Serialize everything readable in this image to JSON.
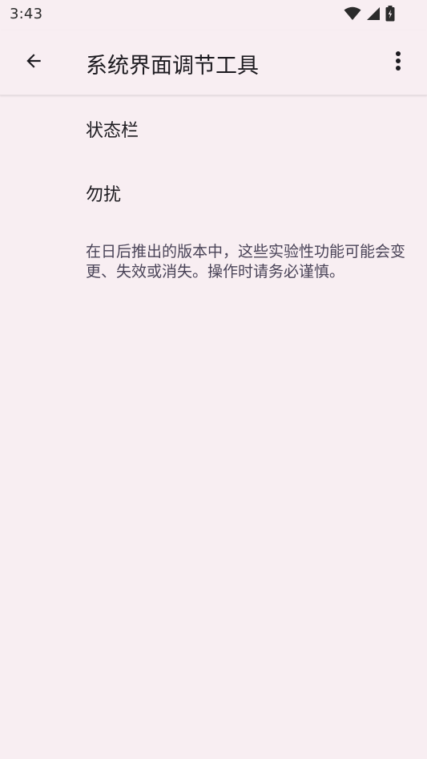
{
  "status_bar": {
    "time": "3:43",
    "icons": [
      "wifi-icon",
      "signal-icon",
      "battery-charging-icon"
    ]
  },
  "app_bar": {
    "title": "系统界面调节工具",
    "back_icon": "arrow-back-icon",
    "overflow_icon": "more-vert-icon"
  },
  "preferences": {
    "items": [
      {
        "label": "状态栏"
      },
      {
        "label": "勿扰"
      }
    ],
    "disclaimer": "在日后推出的版本中，这些实验性功能可能会变更、失效或消失。操作时请务必谨慎。"
  },
  "colors": {
    "background": "#f8eef2",
    "text_primary": "#1d1b20",
    "text_secondary": "#4a4458"
  }
}
